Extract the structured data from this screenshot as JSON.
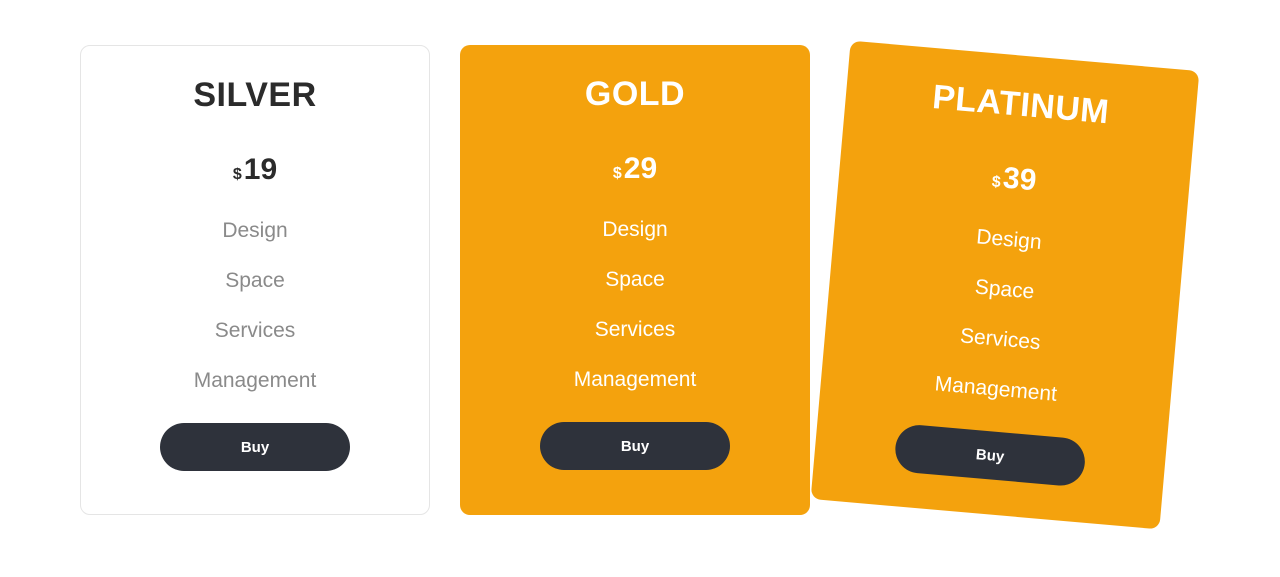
{
  "plans": [
    {
      "name": "SILVER",
      "currency": "$",
      "price": "19",
      "features": [
        "Design",
        "Space",
        "Services",
        "Management"
      ],
      "button": "Buy",
      "variant": "silver"
    },
    {
      "name": "GOLD",
      "currency": "$",
      "price": "29",
      "features": [
        "Design",
        "Space",
        "Services",
        "Management"
      ],
      "button": "Buy",
      "variant": "gold"
    },
    {
      "name": "PLATINUM",
      "currency": "$",
      "price": "39",
      "features": [
        "Design",
        "Space",
        "Services",
        "Management"
      ],
      "button": "Buy",
      "variant": "platinum"
    }
  ]
}
